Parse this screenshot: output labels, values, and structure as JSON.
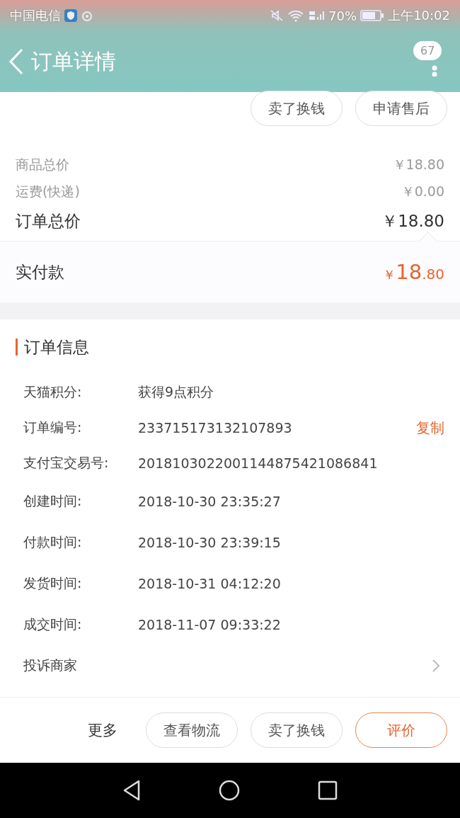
{
  "status_bar": {
    "carrier": "中国电信",
    "battery": "70%",
    "time": "上午10:02"
  },
  "header": {
    "title": "订单详情",
    "badge": "67"
  },
  "top_actions": [
    "卖了换钱",
    "申请售后"
  ],
  "summary": [
    {
      "label": "商品总价",
      "value": "￥18.80",
      "kind": "minor"
    },
    {
      "label": "运费(快递)",
      "value": "￥0.00",
      "kind": "minor"
    },
    {
      "label": "订单总价",
      "value": "￥18.80",
      "kind": "major"
    }
  ],
  "paid": {
    "label": "实付款",
    "currency": "￥",
    "integer": "18",
    "decimal": ".80"
  },
  "order_info": {
    "title": "订单信息",
    "copy_link": "复制",
    "rows": [
      {
        "label": "天猫积分:",
        "value": "获得9点积分"
      },
      {
        "label": "订单编号:",
        "value": "233715173132107893",
        "copyable": true
      },
      {
        "label": "支付宝交易号:",
        "value": "2018103022001144875421086841"
      },
      {
        "label": "创建时间:",
        "value": "2018-10-30 23:35:27"
      },
      {
        "label": "付款时间:",
        "value": "2018-10-30 23:39:15"
      },
      {
        "label": "发货时间:",
        "value": "2018-10-31 04:12:20"
      },
      {
        "label": "成交时间:",
        "value": "2018-11-07 09:33:22"
      }
    ],
    "complaint": "投诉商家"
  },
  "bottom_bar": {
    "more": "更多",
    "buttons": [
      {
        "label": "查看物流",
        "primary": false
      },
      {
        "label": "卖了换钱",
        "primary": false
      },
      {
        "label": "评价",
        "primary": true
      }
    ]
  }
}
